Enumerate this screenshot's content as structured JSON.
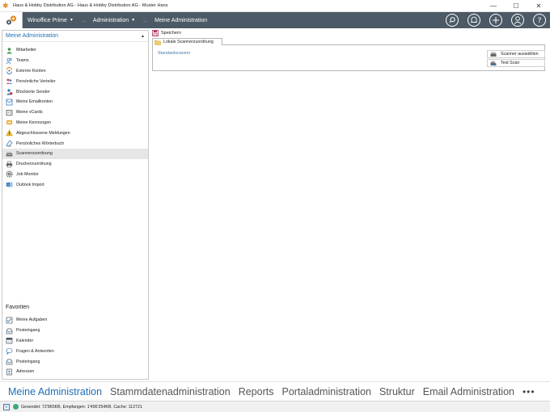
{
  "window": {
    "title": "Haus & Hobby Distribution AG - Haus & Hobby Distribution AG - Muster Hans",
    "minimize": "—",
    "maximize": "☐",
    "close": "✕"
  },
  "nav": {
    "items": [
      {
        "label": "Winoffice Prime"
      },
      {
        "label": "Administration"
      },
      {
        "label": "Meine Administration"
      }
    ],
    "icons": [
      "search-icon",
      "bell-icon",
      "add-icon",
      "user-icon",
      "help-icon"
    ]
  },
  "sidebar": {
    "title": "Meine Administration",
    "pin": "▲",
    "items": [
      {
        "label": "Mitarbeiter",
        "icon": "user-icon"
      },
      {
        "label": "Teams",
        "icon": "team-icon"
      },
      {
        "label": "Externe Konten",
        "icon": "external-accounts-icon"
      },
      {
        "label": "Persönliche Verteiler",
        "icon": "distribution-list-icon"
      },
      {
        "label": "Blockierte Sender",
        "icon": "blocked-sender-icon"
      },
      {
        "label": "Meine Emailkonten",
        "icon": "email-account-icon"
      },
      {
        "label": "Meine vCards",
        "icon": "vcard-icon"
      },
      {
        "label": "Meine Kennungen",
        "icon": "key-icon"
      },
      {
        "label": "Abgeschlossene Meldungen",
        "icon": "warning-icon"
      },
      {
        "label": "Persönliches Wörterbuch",
        "icon": "dictionary-icon"
      },
      {
        "label": "Scannerzuordnung",
        "icon": "scanner-icon"
      },
      {
        "label": "Druckerzuordnung",
        "icon": "printer-icon"
      },
      {
        "label": "Job Monitor",
        "icon": "gear-icon"
      },
      {
        "label": "Outlook Import",
        "icon": "outlook-icon"
      }
    ],
    "favorites_title": "Favoriten",
    "favorites": [
      {
        "label": "Meine Aufgaben",
        "icon": "tasks-icon"
      },
      {
        "label": "Posteingang",
        "icon": "inbox-icon"
      },
      {
        "label": "Kalender",
        "icon": "calendar-icon"
      },
      {
        "label": "Fragen & Antworten",
        "icon": "chat-icon"
      },
      {
        "label": "Posteingang",
        "icon": "inbox-icon"
      },
      {
        "label": "Adressen",
        "icon": "address-book-icon"
      }
    ]
  },
  "main": {
    "save_label": "Speichern",
    "tab_label": "Lokale Scannerzuordnung",
    "field_label": "Standardscanner",
    "select_scanner_label": "Scanner auswählen",
    "test_scan_label": "Test Scan"
  },
  "modules": [
    {
      "label": "Meine Administration",
      "active": true
    },
    {
      "label": "Stammdatenadministration"
    },
    {
      "label": "Reports"
    },
    {
      "label": "Portaladministration"
    },
    {
      "label": "Struktur"
    },
    {
      "label": "Email Administration"
    }
  ],
  "more_label": "•••",
  "status": {
    "text": "Gesendet: 72'865KB, Empfangen: 1'496'254KB, Cache: 112721",
    "square": "≡"
  },
  "colors": {
    "navbar": "#4c5966",
    "accent": "#1f6fb5",
    "status_ok": "#3aa878"
  }
}
